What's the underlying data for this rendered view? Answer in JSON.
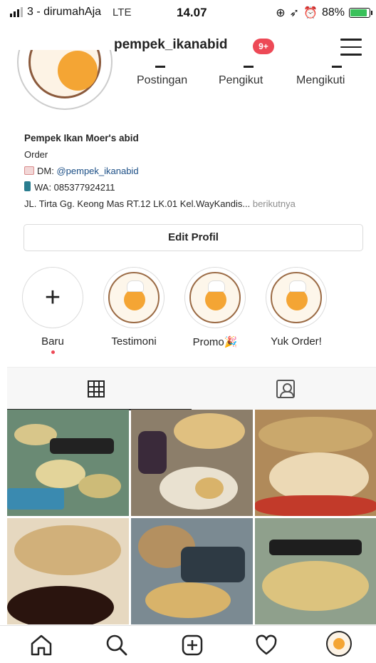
{
  "status_bar": {
    "carrier": "3 - dirumahAja",
    "network": "LTE",
    "time": "14.07",
    "battery_percent": "88%",
    "battery_level": 0.88
  },
  "header": {
    "username": "pempek_ikanabid",
    "notification_badge": "9+"
  },
  "profile": {
    "stats": [
      {
        "label": "Postingan"
      },
      {
        "label": "Pengikut"
      },
      {
        "label": "Mengikuti"
      }
    ],
    "bio": {
      "name": "Pempek Ikan Moer's abid",
      "line1": "Order",
      "dm_prefix": "DM: ",
      "dm_handle": "@pempek_ikanabid",
      "wa": "WA: 085377924211",
      "address": "JL. Tirta Gg. Keong Mas RT.12 LK.01 Kel.WayKandis...",
      "more": "berikutnya"
    },
    "edit_button": "Edit Profil"
  },
  "highlights": [
    {
      "label": "Baru",
      "type": "new"
    },
    {
      "label": "Testimoni",
      "type": "story"
    },
    {
      "label": "Promo🎉",
      "type": "story"
    },
    {
      "label": "Yuk Order!",
      "type": "story"
    }
  ],
  "tabs": [
    {
      "icon": "grid-icon",
      "active": true
    },
    {
      "icon": "tagged-icon",
      "active": false
    }
  ],
  "bottom_nav": [
    {
      "icon": "home-icon"
    },
    {
      "icon": "search-icon"
    },
    {
      "icon": "add-post-icon"
    },
    {
      "icon": "heart-icon"
    },
    {
      "icon": "profile-avatar"
    }
  ],
  "colors": {
    "badge": "#ed4956",
    "link": "#1c4f86",
    "muted": "#8e8e8e",
    "battery": "#39c15a"
  }
}
